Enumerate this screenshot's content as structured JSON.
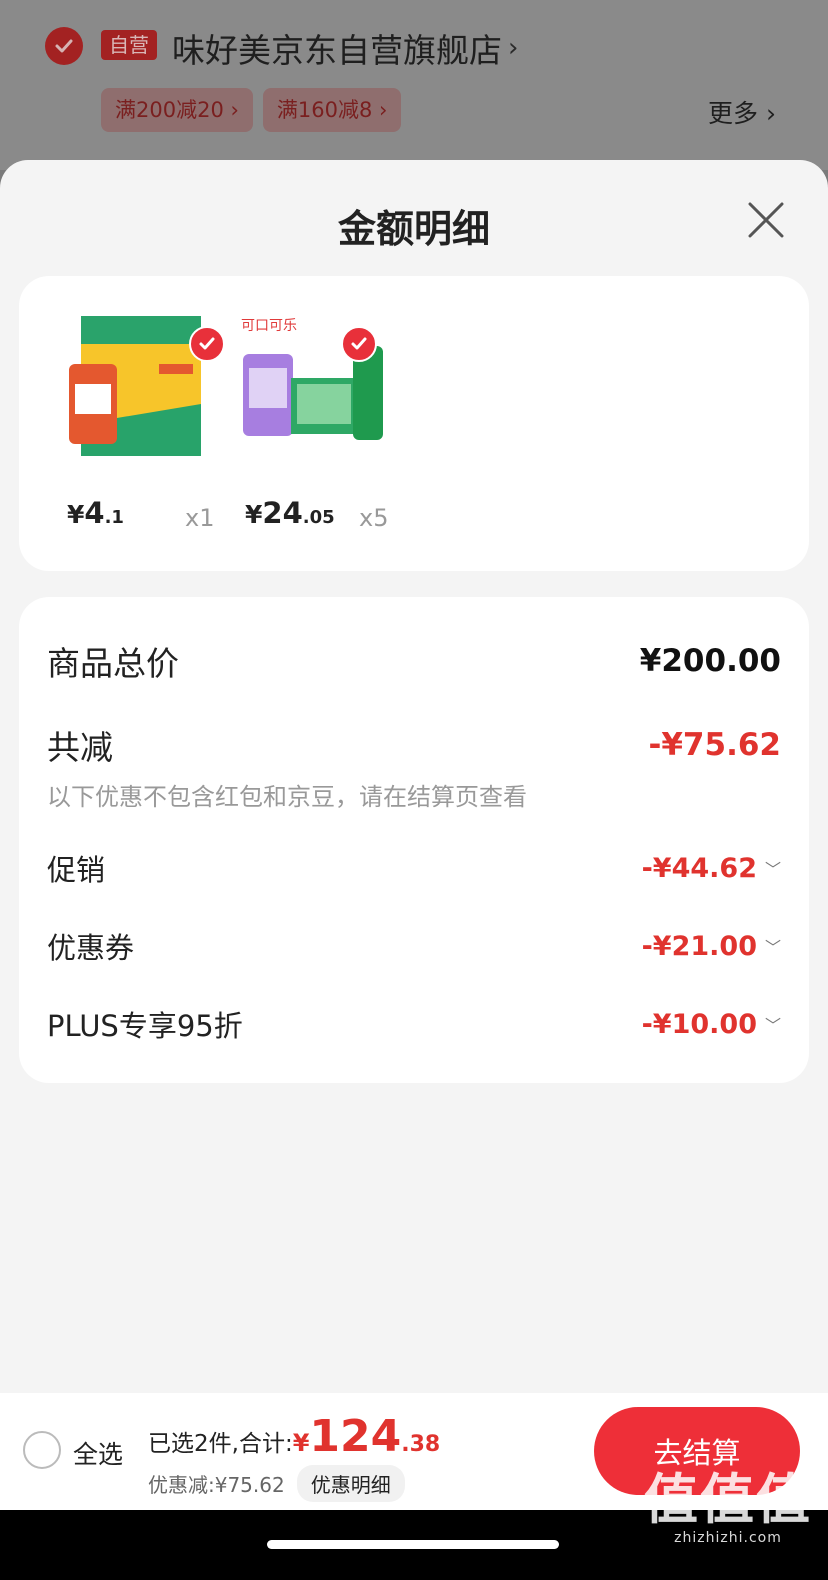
{
  "shop": {
    "self_badge": "自营",
    "name": "味好美京东自营旗舰店",
    "promos": [
      "满200减20",
      "满160减8"
    ],
    "more": "更多"
  },
  "sheet": {
    "title": "金额明细"
  },
  "products": [
    {
      "price_yen": "¥",
      "price_int": "4",
      "price_dec": ".1",
      "qty": "x1",
      "image": "starch-bag",
      "brand": ""
    },
    {
      "price_yen": "¥",
      "price_int": "24",
      "price_dec": ".05",
      "qty": "x5",
      "image": "sprite-pack",
      "brand": "可口可乐"
    }
  ],
  "amounts": {
    "total_label": "商品总价",
    "total_value": "¥200.00",
    "reduced_label": "共减",
    "reduced_value": "-¥75.62",
    "note": "以下优惠不包含红包和京豆，请在结算页查看",
    "items": [
      {
        "label": "促销",
        "value": "-¥44.62"
      },
      {
        "label": "优惠券",
        "value": "-¥21.00"
      },
      {
        "label": "PLUS专享95折",
        "value": "-¥10.00"
      }
    ]
  },
  "bottom": {
    "select_all": "全选",
    "selected_text": "已选2件,合计:",
    "total_yen": "¥",
    "total_int": "124",
    "total_dec": ".38",
    "discount_text": "优惠减:¥75.62",
    "detail_button": "优惠明细",
    "checkout": "去结算"
  },
  "watermark": {
    "big": "值值值",
    "small": "zhizhizhi.com"
  },
  "colors": {
    "accent": "#e0332e",
    "button": "#ee2f38"
  }
}
